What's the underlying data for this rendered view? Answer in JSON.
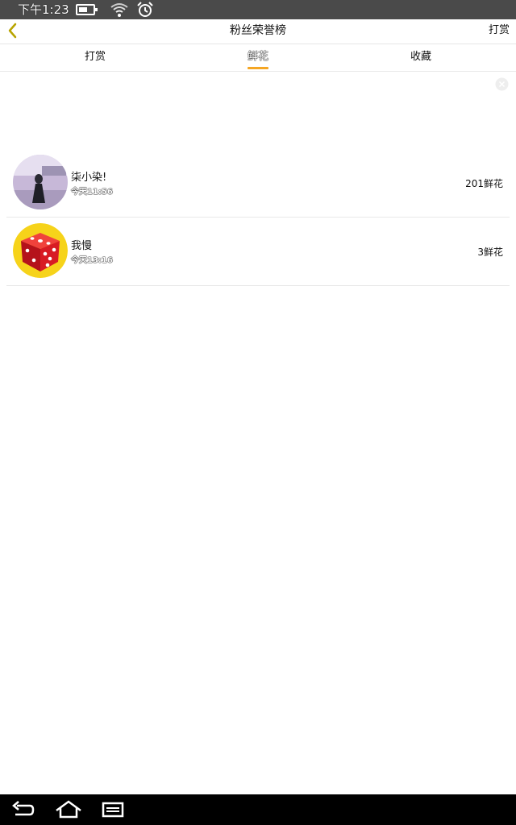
{
  "status_bar": {
    "time": "下午1:23",
    "icons": [
      "battery-icon",
      "wifi-icon",
      "alarm-icon"
    ]
  },
  "header": {
    "title": "粉丝荣誉榜",
    "action_label": "打赏",
    "back_icon": "chevron-left-icon"
  },
  "tabs": [
    {
      "label": "打赏",
      "active": false
    },
    {
      "label": "鲜花",
      "active": true
    },
    {
      "label": "收藏",
      "active": false
    }
  ],
  "accent_color": "#f5a623",
  "list": [
    {
      "name": "柒小染!",
      "time": "今天11:56",
      "amount": "201鲜花",
      "avatar": "photo-avatar"
    },
    {
      "name": "我慢",
      "time": "今天13:16",
      "amount": "3鲜花",
      "avatar": "dice-avatar"
    }
  ],
  "nav_bar": {
    "icons": [
      "back-nav-icon",
      "home-icon",
      "recents-icon"
    ]
  }
}
